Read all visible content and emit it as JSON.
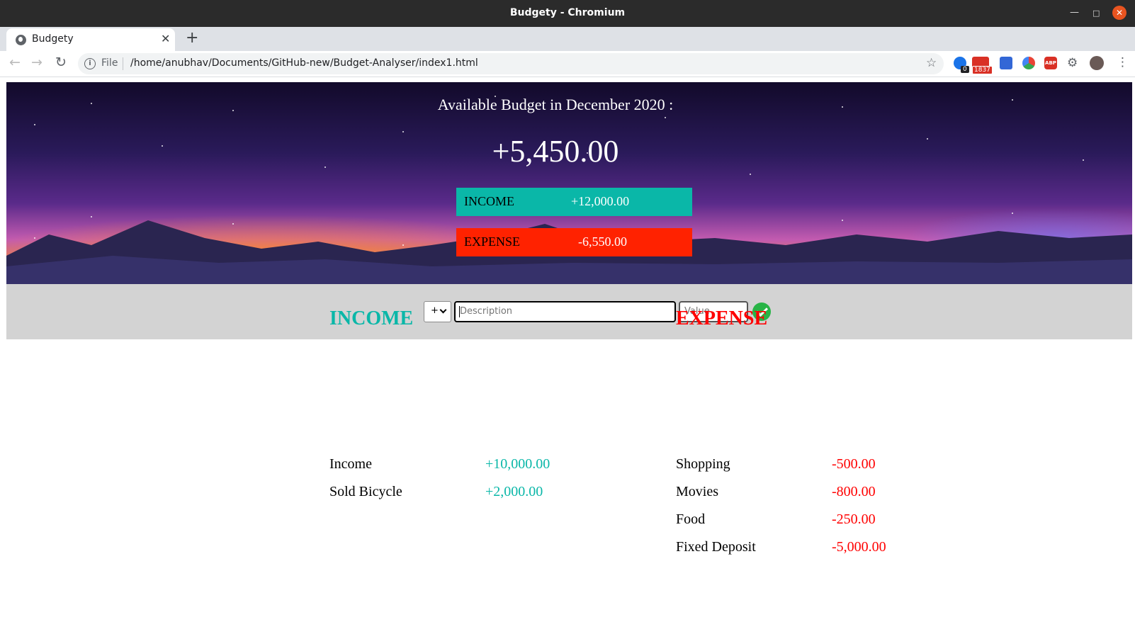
{
  "window": {
    "title": "Budgety - Chromium"
  },
  "tab": {
    "title": "Budgety"
  },
  "address_bar": {
    "scheme_label": "File",
    "url": "/home/anubhav/Documents/GitHub-new/Budget-Analyser/index1.html"
  },
  "extensions": {
    "badge_1": "0",
    "badge_2": "1837",
    "abp_label": "ABP"
  },
  "budget": {
    "title": "Available Budget in December 2020 :",
    "total": "+5,450.00",
    "income_label": "INCOME",
    "income_value": "+12,000.00",
    "expense_label": "EXPENSE",
    "expense_value": "-6,550.00"
  },
  "add_form": {
    "type_option": "+",
    "description_placeholder": "Description",
    "value_placeholder": "Value"
  },
  "income_list": {
    "title": "INCOME",
    "items": [
      {
        "description": "Income",
        "value": "+10,000.00"
      },
      {
        "description": "Sold Bicycle",
        "value": "+2,000.00"
      }
    ]
  },
  "expense_list": {
    "title": "EXPENSE",
    "items": [
      {
        "description": "Shopping",
        "value": "-500.00"
      },
      {
        "description": "Movies",
        "value": "-800.00"
      },
      {
        "description": "Food",
        "value": "-250.00"
      },
      {
        "description": "Fixed Deposit",
        "value": "-5,000.00"
      }
    ]
  },
  "colors": {
    "income": "#0ab7a8",
    "expense": "#ff2200",
    "add_button": "#28b446"
  }
}
